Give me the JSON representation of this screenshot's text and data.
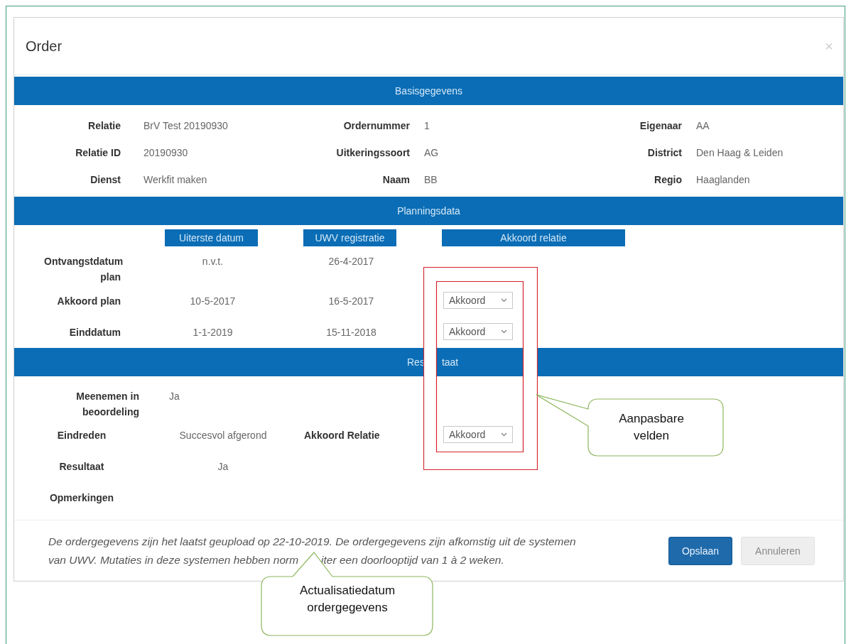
{
  "dialog": {
    "title": "Order",
    "close": "×"
  },
  "basisgegevens": {
    "heading": "Basisgegevens",
    "rows": [
      [
        {
          "label": "Relatie",
          "value": "BrV Test 20190930"
        },
        {
          "label": "Ordernummer",
          "value": "1"
        },
        {
          "label": "Eigenaar",
          "value": "AA"
        }
      ],
      [
        {
          "label": "Relatie ID",
          "value": "20190930"
        },
        {
          "label": "Uitkeringssoort",
          "value": "AG"
        },
        {
          "label": "District",
          "value": "Den Haag & Leiden"
        }
      ],
      [
        {
          "label": "Dienst",
          "value": "Werkfit maken"
        },
        {
          "label": "Naam",
          "value": "BB"
        },
        {
          "label": "Regio",
          "value": "Haaglanden"
        }
      ]
    ]
  },
  "planningsdata": {
    "heading": "Planningsdata",
    "columns": [
      "Uiterste datum",
      "UWV registratie",
      "Akkoord relatie"
    ],
    "rows": [
      {
        "label": "Ontvangstdatum plan",
        "cells": [
          "n.v.t.",
          "26-4-2017"
        ]
      },
      {
        "label": "Akkoord plan",
        "cells": [
          "10-5-2017",
          "16-5-2017"
        ],
        "select": "Akkoord"
      },
      {
        "label": "Einddatum",
        "cells": [
          "1-1-2019",
          "15-11-2018"
        ],
        "select": "Akkoord"
      }
    ]
  },
  "resultaat": {
    "heading_parts": [
      "Res",
      "taat"
    ],
    "rows": [
      {
        "label": "Meenemen in beoordeling",
        "value": "Ja"
      },
      {
        "label": "Eindreden",
        "value": "Succesvol afgerond",
        "extra_label": "Akkoord Relatie",
        "select": "Akkoord"
      },
      {
        "label": "Resultaat",
        "value": "Ja"
      },
      {
        "label": "Opmerkingen"
      }
    ]
  },
  "footer": {
    "note_line1": "De ordergegevens zijn het laatst geupload op 22-10-2019. De ordergegevens zijn afkomstig uit de systemen",
    "note_line2_parts": [
      "van UWV. Mutaties in deze systemen hebben norm",
      "iter een doorlooptijd van 1 à 2 weken."
    ],
    "buttons": [
      {
        "label": "Opslaan",
        "kind": "primary"
      },
      {
        "label": "Annuleren",
        "kind": "default"
      }
    ]
  },
  "annotations": [
    {
      "text": "Aanpasbare velden",
      "kind": "fields"
    },
    {
      "text": "Actualisatiedatum ordergegevens",
      "kind": "date"
    }
  ]
}
